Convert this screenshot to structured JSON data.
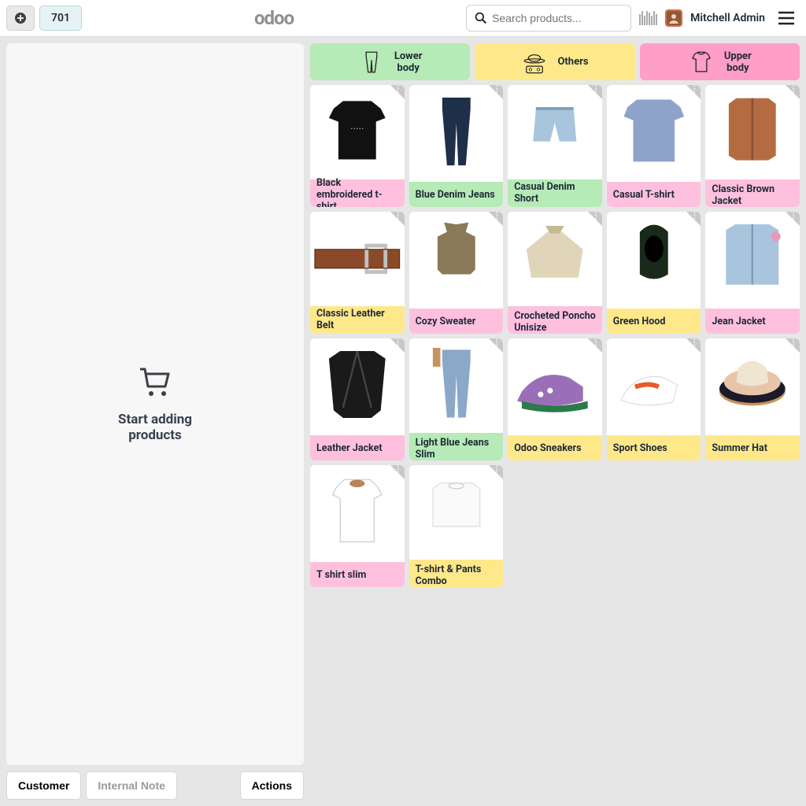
{
  "header": {
    "order_number": "701",
    "logo": "odoo",
    "search_placeholder": "Search products...",
    "user_name": "Mitchell Admin"
  },
  "left": {
    "empty_line1": "Start adding",
    "empty_line2": "products",
    "btn_customer": "Customer",
    "btn_note": "Internal Note",
    "btn_actions": "Actions"
  },
  "categories": [
    {
      "id": "lower",
      "label": "Lower body",
      "cls": "cat-lower",
      "icon": "pants"
    },
    {
      "id": "others",
      "label": "Others",
      "cls": "cat-others",
      "icon": "hat"
    },
    {
      "id": "upper",
      "label": "Upper body",
      "cls": "cat-upper",
      "icon": "shirt"
    }
  ],
  "products": [
    {
      "name": "Black embroidered t-shirt",
      "label_cls": "l-pink",
      "two": true,
      "svg": "tshirt-black"
    },
    {
      "name": "Blue Denim Jeans",
      "label_cls": "l-green",
      "two": false,
      "svg": "jeans-blue"
    },
    {
      "name": "Casual Denim Short",
      "label_cls": "l-green",
      "two": false,
      "svg": "shorts"
    },
    {
      "name": "Casual T-shirt",
      "label_cls": "l-pink",
      "two": false,
      "svg": "tshirt-blue"
    },
    {
      "name": "Classic Brown Jacket",
      "label_cls": "l-pink",
      "two": true,
      "svg": "jacket-brown"
    },
    {
      "name": "Classic Leather Belt",
      "label_cls": "l-yellow",
      "two": false,
      "svg": "belt"
    },
    {
      "name": "Cozy Sweater",
      "label_cls": "l-pink",
      "two": false,
      "svg": "sweater"
    },
    {
      "name": "Crocheted Poncho Unisize",
      "label_cls": "l-pink",
      "two": true,
      "svg": "poncho"
    },
    {
      "name": "Green Hood",
      "label_cls": "l-yellow",
      "two": false,
      "svg": "hood"
    },
    {
      "name": "Jean Jacket",
      "label_cls": "l-pink",
      "two": false,
      "svg": "jean-jacket"
    },
    {
      "name": "Leather Jacket",
      "label_cls": "l-pink",
      "two": false,
      "svg": "leather-jacket"
    },
    {
      "name": "Light Blue Jeans Slim",
      "label_cls": "l-green",
      "two": true,
      "svg": "jeans-light"
    },
    {
      "name": "Odoo Sneakers",
      "label_cls": "l-yellow",
      "two": false,
      "svg": "sneakers"
    },
    {
      "name": "Sport Shoes",
      "label_cls": "l-yellow",
      "two": false,
      "svg": "sport-shoes"
    },
    {
      "name": "Summer Hat",
      "label_cls": "l-yellow",
      "two": false,
      "svg": "summer-hat"
    },
    {
      "name": "T shirt slim",
      "label_cls": "l-pink",
      "two": false,
      "svg": "tshirt-white"
    },
    {
      "name": "T-shirt & Pants Combo",
      "label_cls": "l-yellow",
      "two": true,
      "svg": "combo"
    }
  ]
}
